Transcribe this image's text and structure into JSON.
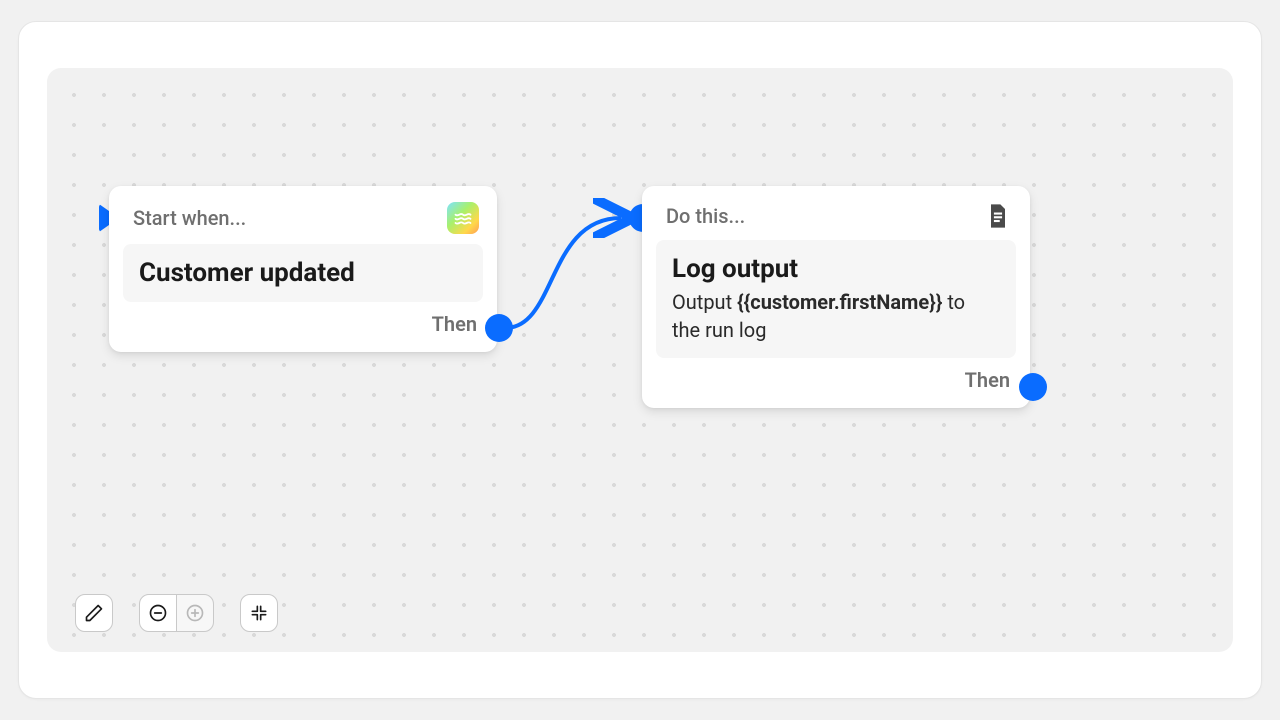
{
  "colors": {
    "accent": "#0a6cff"
  },
  "node1": {
    "header": "Start when...",
    "title": "Customer updated",
    "then": "Then"
  },
  "node2": {
    "header": "Do this...",
    "title": "Log output",
    "desc_prefix": "Output ",
    "desc_var": "{{customer.firstName}}",
    "desc_suffix": " to the run log",
    "then": "Then"
  },
  "toolbar": {
    "edit": "edit",
    "zoom_out": "zoom out",
    "zoom_in": "zoom in",
    "fit": "fit to screen"
  }
}
